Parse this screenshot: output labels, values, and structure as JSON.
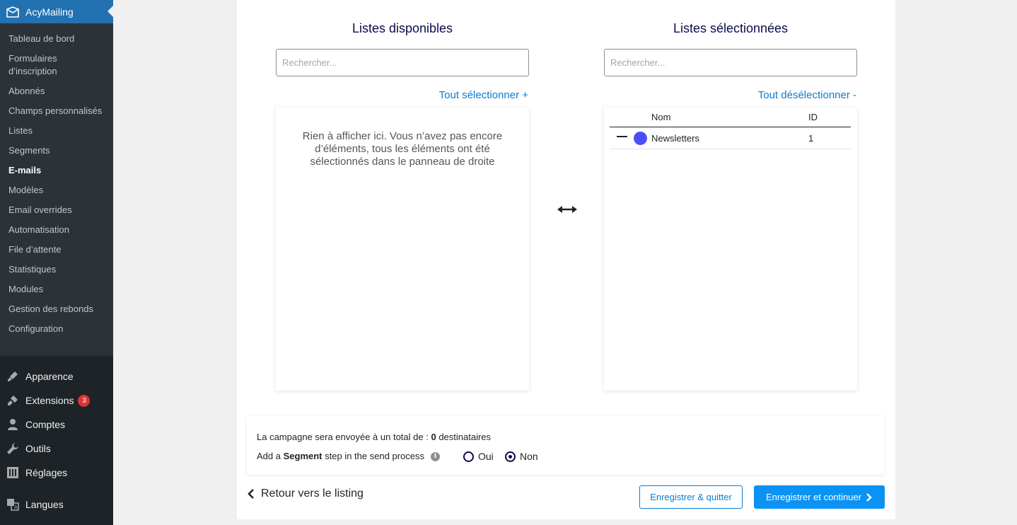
{
  "sidebar": {
    "plugin_name": "AcyMailing",
    "submenu": [
      {
        "label": "Tableau de bord",
        "active": false
      },
      {
        "label": "Formulaires d’inscription",
        "active": false
      },
      {
        "label": "Abonnés",
        "active": false
      },
      {
        "label": "Champs personnalisés",
        "active": false
      },
      {
        "label": "Listes",
        "active": false
      },
      {
        "label": "Segments",
        "active": false
      },
      {
        "label": "E-mails",
        "active": true
      },
      {
        "label": "Modèles",
        "active": false
      },
      {
        "label": "Email overrides",
        "active": false
      },
      {
        "label": "Automatisation",
        "active": false
      },
      {
        "label": "File d’attente",
        "active": false
      },
      {
        "label": "Statistiques",
        "active": false
      },
      {
        "label": "Modules",
        "active": false
      },
      {
        "label": "Gestion des rebonds",
        "active": false
      },
      {
        "label": "Configuration",
        "active": false
      }
    ],
    "mainmenu": [
      {
        "label": "Apparence",
        "icon": "paintbrush-icon"
      },
      {
        "label": "Extensions",
        "icon": "plugin-icon",
        "badge": "3"
      },
      {
        "label": "Comptes",
        "icon": "user-icon"
      },
      {
        "label": "Outils",
        "icon": "wrench-icon"
      },
      {
        "label": "Réglages",
        "icon": "settings-icon"
      },
      {
        "label": "Langues",
        "icon": "translate-icon"
      }
    ]
  },
  "available": {
    "title": "Listes disponibles",
    "search_placeholder": "Rechercher...",
    "select_all": "Tout sélectionner +",
    "empty_message": "Rien à afficher ici. Vous n’avez pas encore d’éléments, tous les éléments ont été sélectionnés dans le panneau de droite"
  },
  "selected": {
    "title": "Listes sélectionnées",
    "search_placeholder": "Rechercher...",
    "deselect_all": "Tout désélectionner -",
    "columns": {
      "name": "Nom",
      "id": "ID"
    },
    "rows": [
      {
        "name": "Newsletters",
        "id": "1",
        "color": "#4c4ef5"
      }
    ]
  },
  "summary": {
    "recipients_prefix": "La campagne sera envoyée à un total de :",
    "recipients_count": "0",
    "recipients_suffix": "destinataires",
    "segment_prefix": "Add a",
    "segment_bold": "Segment",
    "segment_suffix": "step in the send process",
    "option_yes": "Oui",
    "option_no": "Non",
    "selected_option": "Non"
  },
  "footer": {
    "back_label": "Retour vers le listing",
    "save_quit_label": "Enregistrer & quitter",
    "save_continue_label": "Enregistrer et continuer"
  },
  "colors": {
    "accent": "#0a7dd1",
    "primary_button": "#0a93f5",
    "title": "#0b0b4f",
    "sidebar": "#1d2327",
    "badge": "#d63638"
  }
}
